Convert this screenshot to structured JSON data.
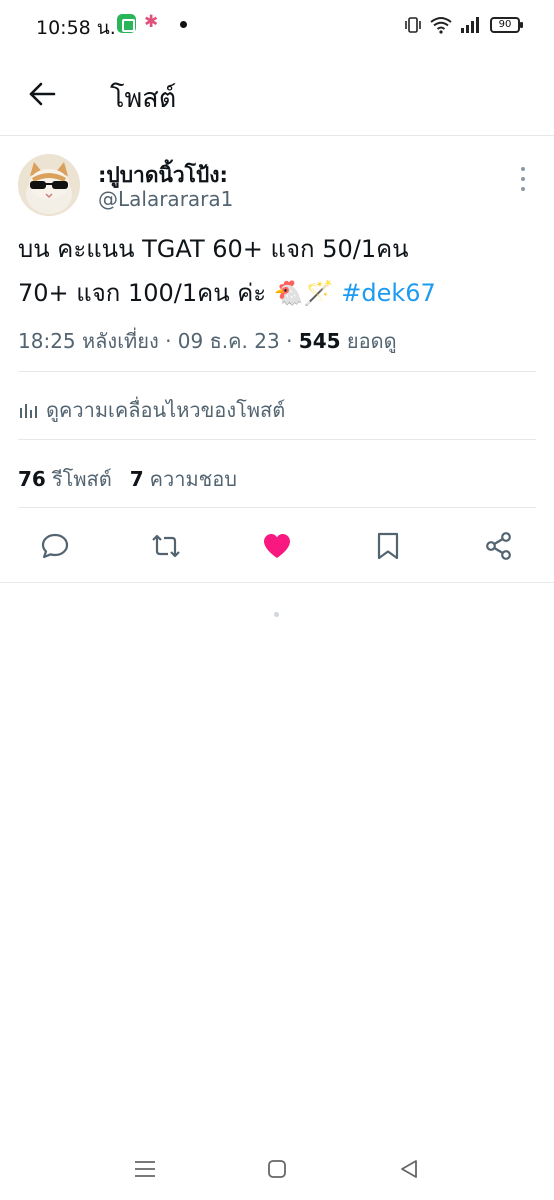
{
  "status_bar": {
    "time": "10:58 น.",
    "battery": "90",
    "icons": [
      "green-app-icon",
      "colorful-app-icon",
      "notification-dot-icon",
      "vibrate-icon",
      "wifi-icon",
      "signal-icon",
      "battery-icon"
    ]
  },
  "header": {
    "back_icon": "arrow-left-icon",
    "title": "โพสต์"
  },
  "post": {
    "display_name": ":ปูบาดนิ้วโป้ง:",
    "handle": "@Lalararara1",
    "text_line1": "บน คะแนน TGAT 60+ แจก 50/1คน",
    "text_line2_a": "70+ แจก 100/1คน ค่ะ",
    "emojis": "🐔🪄",
    "hashtag": "#dek67",
    "time": "18:25 หลังเที่ยง",
    "date": "09 ธ.ค. 23",
    "views_count": "545",
    "views_label": "ยอดดู",
    "engagement_label": "ดูความเคลื่อนไหวของโพสต์",
    "retweets_count": "76",
    "retweets_label": "รีโพสต์",
    "likes_count": "7",
    "likes_label": "ความชอบ"
  },
  "actions": [
    "reply-icon",
    "repost-icon",
    "like-icon",
    "bookmark-icon",
    "share-icon"
  ],
  "colors": {
    "text_primary": "#0f1419",
    "text_secondary": "#536471",
    "link": "#1d9bf0",
    "like": "#f91880",
    "divider": "#e6e9ec"
  },
  "nav_bar": [
    "menu-icon",
    "home-icon",
    "back-icon"
  ]
}
